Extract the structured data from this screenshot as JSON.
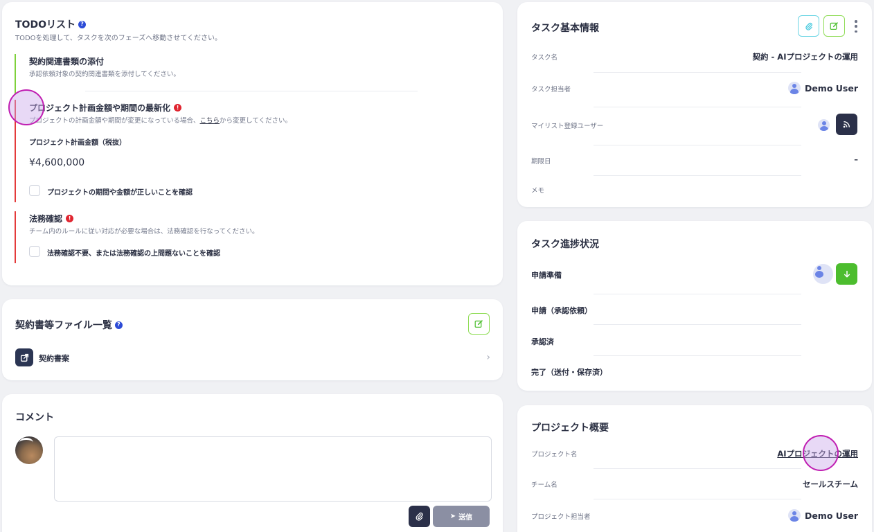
{
  "todo": {
    "title": "TODOリスト",
    "subtitle": "TODOを処理して、タスクを次のフェーズへ移動させてください。",
    "sections": [
      {
        "title": "契約関連書類の添付",
        "desc": "承認依頼対象の契約関連書類を添付してください。",
        "status": "done"
      },
      {
        "title": "プロジェクト計画金額や期間の最新化",
        "desc_before": "プロジェクトの計画金額や期間が変更になっている場合、",
        "desc_link": "こちら",
        "desc_after": "から変更してください。",
        "amount_label": "プロジェクト計画金額（税抜）",
        "amount_value": "¥4,600,000",
        "checkbox_label": "プロジェクトの期間や金額が正しいことを確認",
        "status": "alert"
      },
      {
        "title": "法務確認",
        "desc": "チーム内のルールに従い対応が必要な場合は、法務確認を行なってください。",
        "checkbox_label": "法務確認不要、または法務確認の上問題ないことを確認",
        "status": "alert"
      }
    ]
  },
  "files": {
    "title": "契約書等ファイル一覧",
    "items": [
      {
        "label": "契約書案"
      }
    ]
  },
  "comment": {
    "title": "コメント",
    "placeholder": "",
    "send_label": "送信"
  },
  "task_info": {
    "title": "タスク基本情報",
    "rows": [
      {
        "label": "タスク名",
        "value": "契約 - AIプロジェクトの運用"
      },
      {
        "label": "タスク担当者",
        "value": "Demo User"
      },
      {
        "label": "マイリスト登録ユーザー",
        "value": ""
      },
      {
        "label": "期限日",
        "value": "–"
      },
      {
        "label": "メモ",
        "value": ""
      }
    ]
  },
  "task_progress": {
    "title": "タスク進捗状況",
    "steps": [
      {
        "label": "申請準備"
      },
      {
        "label": "申請（承認依頼）"
      },
      {
        "label": "承認済"
      },
      {
        "label": "完了（送付・保存済）"
      }
    ]
  },
  "project": {
    "title": "プロジェクト概要",
    "rows": [
      {
        "label": "プロジェクト名",
        "value": "AIプロジェクトの運用"
      },
      {
        "label": "チーム名",
        "value": "セールスチーム"
      },
      {
        "label": "プロジェクト担当者",
        "value": "Demo User"
      }
    ]
  },
  "colors": {
    "accent_green": "#56c23a",
    "alert_red": "#e0242f",
    "help_blue": "#2c4bd6",
    "dark_navy": "#2b3049"
  }
}
